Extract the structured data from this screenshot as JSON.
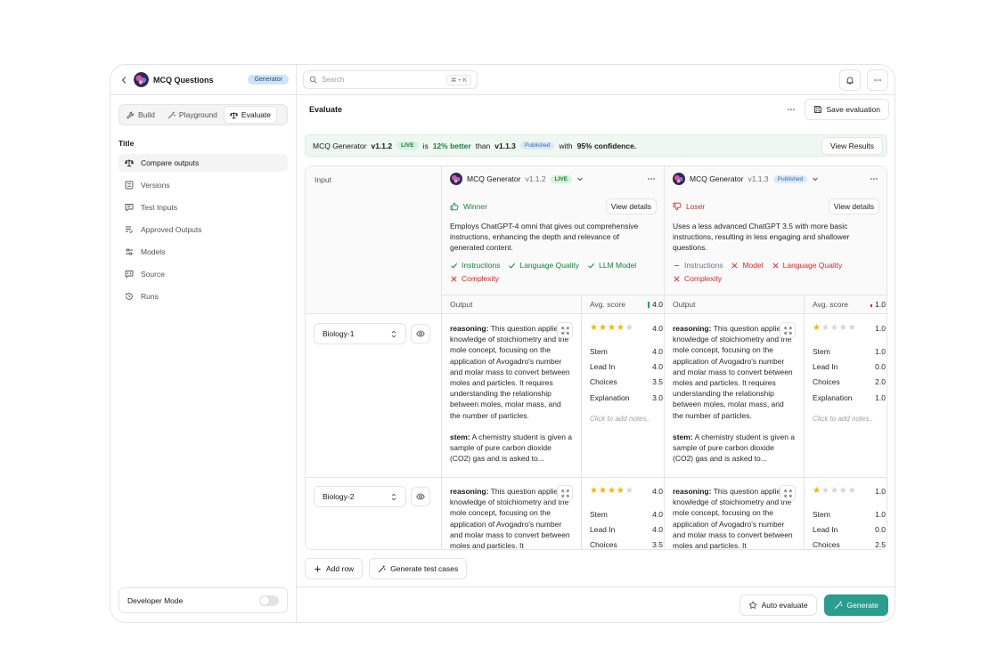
{
  "sidebar": {
    "app_title": "MCQ Questions",
    "app_badge": "Generator",
    "tabs": [
      {
        "label": "Build",
        "icon": "wrench-icon"
      },
      {
        "label": "Playground",
        "icon": "wand-icon"
      },
      {
        "label": "Evaluate",
        "icon": "scale-icon"
      }
    ],
    "active_tab": "Evaluate",
    "section_title": "Title",
    "items": [
      {
        "label": "Compare outputs",
        "icon": "scale-icon"
      },
      {
        "label": "Versions",
        "icon": "list-icon"
      },
      {
        "label": "Test Inputs",
        "icon": "message-icon"
      },
      {
        "label": "Approved Outputs",
        "icon": "list-check-icon"
      },
      {
        "label": "Models",
        "icon": "sliders-icon"
      },
      {
        "label": "Source",
        "icon": "code-icon"
      },
      {
        "label": "Runs",
        "icon": "history-icon"
      }
    ],
    "active_item": "Compare outputs",
    "dev_mode_label": "Developer Mode",
    "dev_mode_on": false
  },
  "topbar": {
    "search_placeholder": "Search",
    "search_shortcut": "⌘ + K"
  },
  "evaluate": {
    "title": "Evaluate",
    "save_label": "Save evaluation"
  },
  "banner": {
    "model": "MCQ Generator",
    "version_a": "v1.1.2",
    "badge_a": "LIVE",
    "is": "is",
    "better": "12% better",
    "than": "than",
    "version_b": "v1.1.3",
    "badge_b": "Published",
    "with": "with",
    "confidence": "95% confidence.",
    "button": "View Results"
  },
  "grid": {
    "input_header": "Input",
    "output_header": "Output",
    "avg_header": "Avg. score",
    "columns": [
      {
        "model": "MCQ Generator",
        "version": "v1.1.2",
        "status": "LIVE",
        "result": "Winner",
        "view_details": "View details",
        "description": "Employs ChatGPT-4 omni that gives out comprehensive instructions, enhancing the depth and relevance of generated content.",
        "tags": [
          {
            "label": "Instructions",
            "state": "pass"
          },
          {
            "label": "Language Quality",
            "state": "pass"
          },
          {
            "label": "LLM Model",
            "state": "pass"
          },
          {
            "label": "Complexity",
            "state": "fail"
          }
        ],
        "avg_score": "4.0"
      },
      {
        "model": "MCQ Generator",
        "version": "v1.1.3",
        "status": "Published",
        "result": "Loser",
        "view_details": "View details",
        "description": "Uses a less advanced ChatGPT 3.5 with more basic instructions, resulting in less engaging and shallower questions.",
        "tags": [
          {
            "label": "Instructions",
            "state": "neutral"
          },
          {
            "label": "Model",
            "state": "fail"
          },
          {
            "label": "Language Quality",
            "state": "fail"
          },
          {
            "label": "Complexity",
            "state": "fail"
          }
        ],
        "avg_score": "1.0"
      }
    ],
    "rows": [
      {
        "input": "Biology-1",
        "outputs": [
          {
            "reasoning_label": "reasoning:",
            "reasoning": " This question applies knowledge of stoichiometry and the mole concept, focusing on the application of Avogadro's number and molar mass to convert between moles and particles. It requires understanding the relationship between moles, molar mass, and the number of particles.",
            "stem_label": "stem:",
            "stem": " A chemistry student is given a sample of pure carbon dioxide (CO2) gas and is asked to...",
            "stars": 4,
            "score": "4.0",
            "metrics": [
              [
                "Stem",
                "4.0"
              ],
              [
                "Lead In",
                "4.0"
              ],
              [
                "Choices",
                "3.5"
              ],
              [
                "Explanation",
                "3.0"
              ]
            ],
            "notes": "Click to add notes.."
          },
          {
            "reasoning_label": "reasoning:",
            "reasoning": " This question applies knowledge of stoichiometry and the mole concept, focusing on the application of Avogadro's number and molar mass to convert between moles and particles. It requires understanding the relationship between moles, molar mass, and the number of particles.",
            "stem_label": "stem:",
            "stem": " A chemistry student is given a sample of pure carbon dioxide (CO2) gas and is asked to...",
            "stars": 1,
            "score": "1.0",
            "metrics": [
              [
                "Stem",
                "1.0"
              ],
              [
                "Lead In",
                "0.0"
              ],
              [
                "Choices",
                "2.0"
              ],
              [
                "Explanation",
                "1.0"
              ]
            ],
            "notes": "Click to add notes.."
          }
        ]
      },
      {
        "input": "Biology-2",
        "outputs": [
          {
            "reasoning_label": "reasoning:",
            "reasoning": " This question applies knowledge of stoichiometry and the mole concept, focusing on the application of Avogadro's number and molar mass to convert between moles and particles. It",
            "stars": 4,
            "score": "4.0",
            "metrics": [
              [
                "Stem",
                "4.0"
              ],
              [
                "Lead In",
                "4.0"
              ],
              [
                "Choices",
                "3.5"
              ]
            ]
          },
          {
            "reasoning_label": "reasoning:",
            "reasoning": " This question applies knowledge of stoichiometry and the mole concept, focusing on the application of Avogadro's number and molar mass to convert between moles and particles. It",
            "stars": 1,
            "score": "1.0",
            "metrics": [
              [
                "Stem",
                "1.0"
              ],
              [
                "Lead In",
                "0.0"
              ],
              [
                "Choices",
                "2.5"
              ]
            ]
          }
        ]
      }
    ]
  },
  "actions": {
    "add_row": "Add row",
    "generate_tests": "Generate test cases",
    "auto_evaluate": "Auto evaluate",
    "generate": "Generate"
  },
  "colors": {
    "accent": "#2a9d8f",
    "pass": "#16803c",
    "fail": "#dc2626",
    "star": "#f5b400"
  }
}
